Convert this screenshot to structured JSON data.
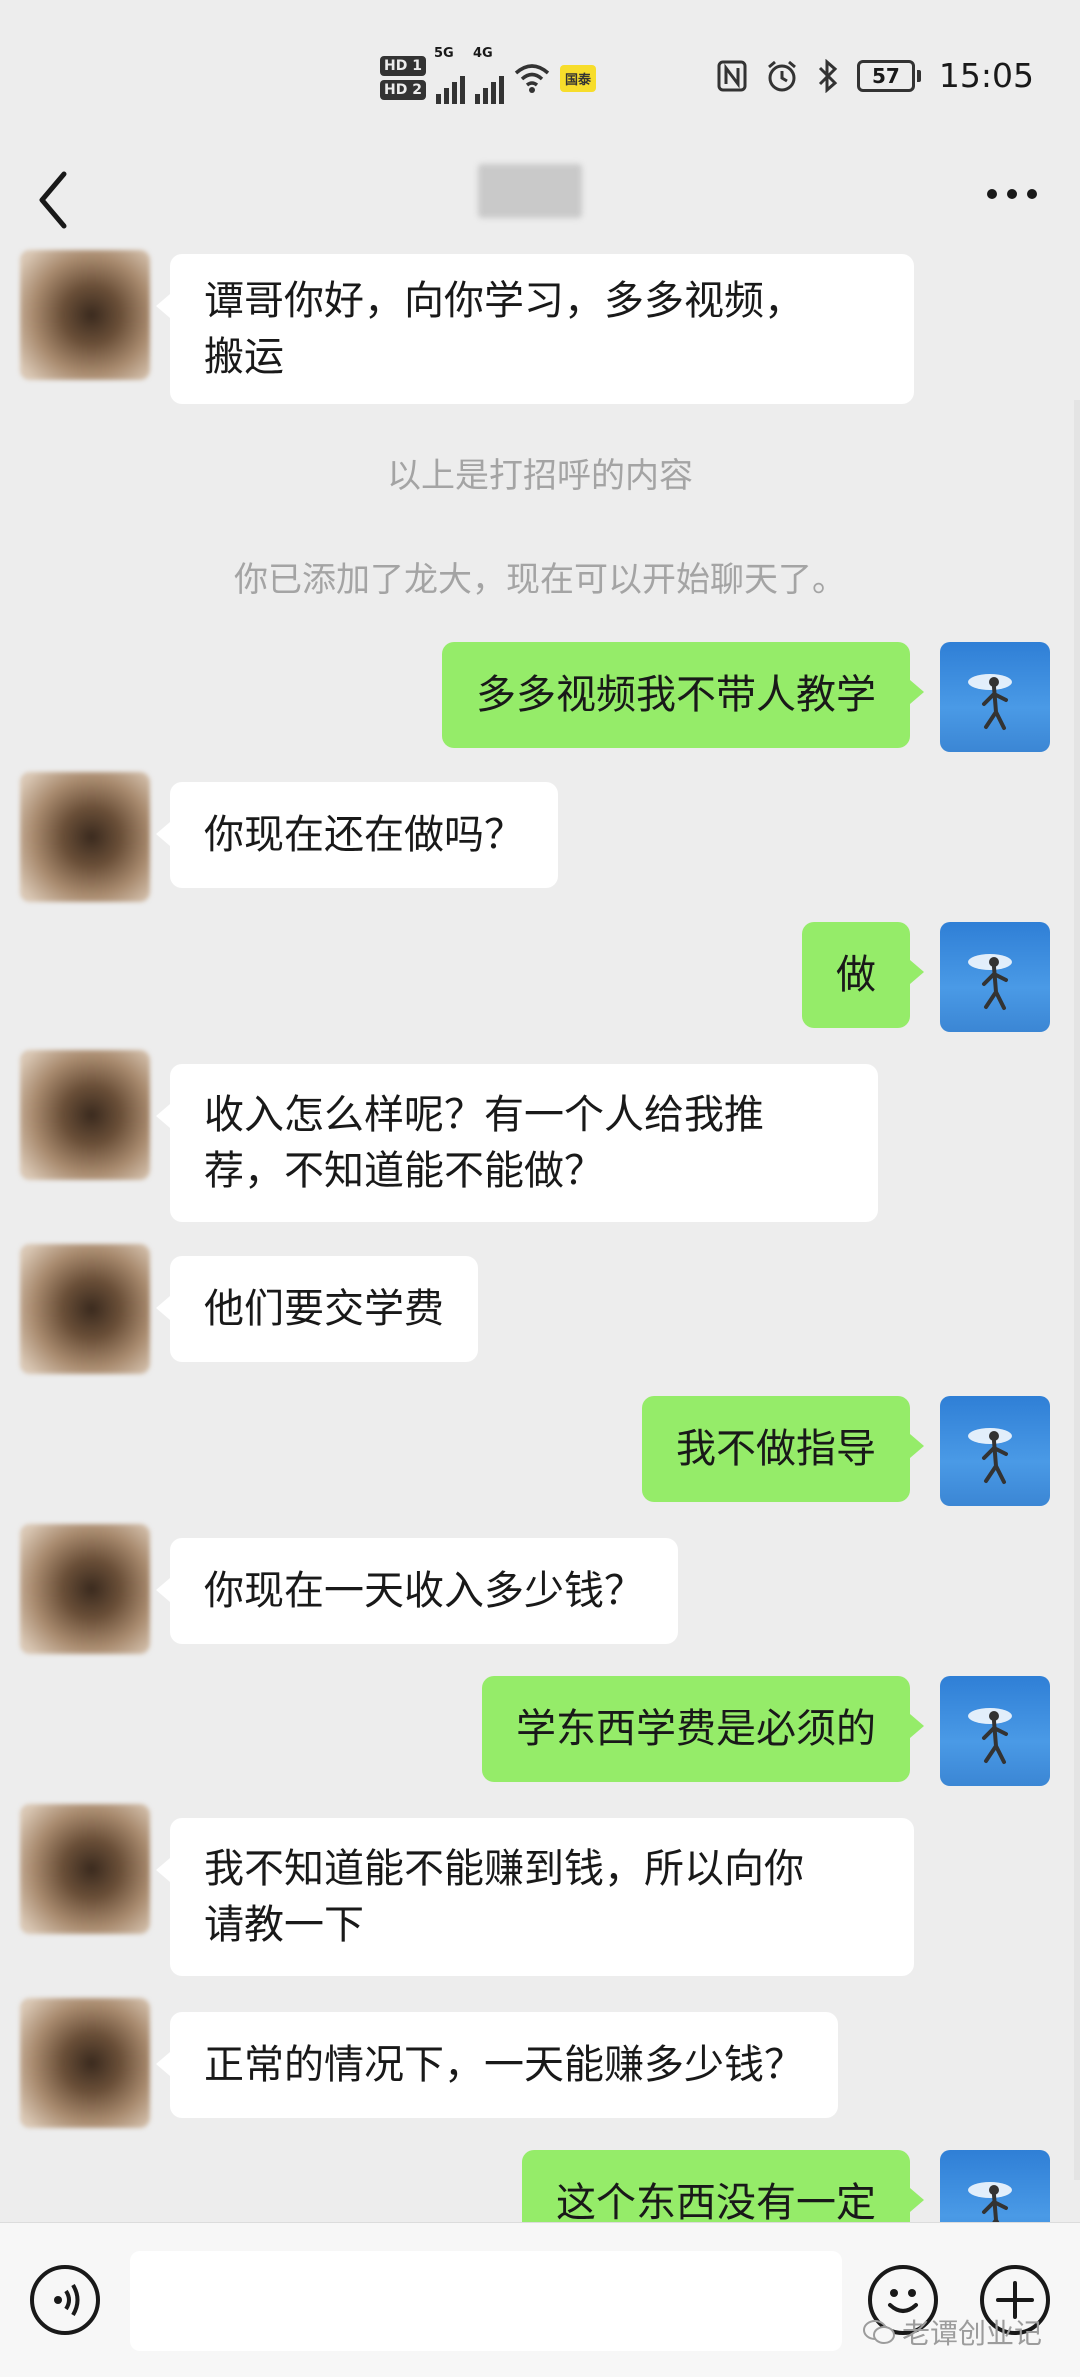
{
  "status_bar": {
    "hd1": "HD 1",
    "hd2": "HD 2",
    "net1": "5G",
    "net2": "4G",
    "tag": "国泰",
    "battery": "57",
    "time": "15:05"
  },
  "nav": {
    "back_icon": "chevron-left-icon",
    "more_icon": "more-dots-icon"
  },
  "messages": [
    {
      "from": "contact",
      "text_lines": [
        "谭哥你好，向你学习，多多视频，",
        "搬运"
      ]
    },
    {
      "type": "system",
      "text": "以上是打招呼的内容"
    },
    {
      "type": "system",
      "text": "你已添加了龙大，现在可以开始聊天了。"
    },
    {
      "from": "me",
      "text": "多多视频我不带人教学"
    },
    {
      "from": "contact",
      "text": "你现在还在做吗？"
    },
    {
      "from": "me",
      "text": "做"
    },
    {
      "from": "contact",
      "text_lines": [
        "收入怎么样呢？有一个人给我推",
        "荐，不知道能不能做？"
      ]
    },
    {
      "from": "contact",
      "text": "他们要交学费"
    },
    {
      "from": "me",
      "text": "我不做指导"
    },
    {
      "from": "contact",
      "text": "你现在一天收入多少钱？"
    },
    {
      "from": "me",
      "text": "学东西学费是必须的"
    },
    {
      "from": "contact",
      "text_lines": [
        "我不知道能不能赚到钱，所以向你",
        "请教一下"
      ]
    },
    {
      "from": "contact",
      "text": "正常的情况下，一天能赚多少钱？"
    },
    {
      "from": "me",
      "text": "这个东西没有一定"
    }
  ],
  "input_bar": {
    "voice_icon": "voice-icon",
    "emoji_icon": "emoji-icon",
    "plus_icon": "plus-icon"
  },
  "watermark": "老谭创业记"
}
